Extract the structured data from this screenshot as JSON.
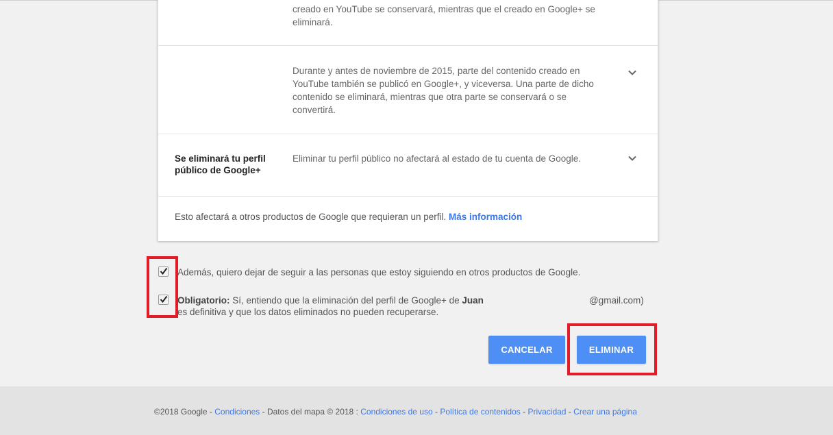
{
  "card": {
    "row1": {
      "description": "creado en YouTube se conservará, mientras que el creado en Google+ se eliminará."
    },
    "row2": {
      "description": "Durante y antes de noviembre de 2015, parte del contenido creado en YouTube también se publicó en Google+, y viceversa. Una parte de dicho contenido se eliminará, mientras que otra parte se conservará o se convertirá."
    },
    "row3": {
      "title": "Se eliminará tu perfil público de Google+",
      "description": "Eliminar tu perfil público no afectará al estado de tu cuenta de Google."
    },
    "info": {
      "text": "Esto afectará a otros productos de Google que requieran un perfil.",
      "link": "Más información"
    }
  },
  "checkboxes": {
    "unfollow": {
      "checked": true,
      "text": "Además, quiero dejar de seguir a las personas que estoy siguiendo en otros productos de Google."
    },
    "required": {
      "checked": true,
      "label": "Obligatorio:",
      "text_part1": "Sí, entiendo que la eliminación del perfil de Google+ de",
      "name": "Juan",
      "email_suffix": "@gmail.com)",
      "text_part2": "es definitiva y que los datos eliminados no pueden recuperarse."
    }
  },
  "buttons": {
    "cancel": "CANCELAR",
    "delete": "ELIMINAR"
  },
  "footer": {
    "copyright": "©2018 Google -",
    "terms": "Condiciones",
    "map_data": "- Datos del mapa © 2018 :",
    "terms_of_use": "Condiciones de uso",
    "sep1": "-",
    "content_policy": "Política de contenidos",
    "sep2": "-",
    "privacy": "Privacidad",
    "sep3": "-",
    "create_page": "Crear una página"
  },
  "colors": {
    "accent": "#4d8ff5",
    "link": "#3b78e7",
    "highlight": "#e21b24"
  }
}
